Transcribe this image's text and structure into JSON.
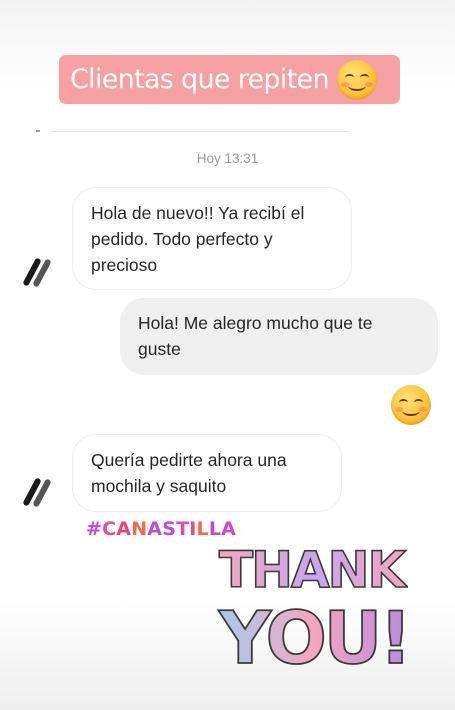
{
  "story": {
    "title": "Clientas que repiten",
    "title_emoji": "smiling-face-icon",
    "title_bg": "#f6a0a3"
  },
  "chat": {
    "timestamp": "Hoy 13:31",
    "messages": [
      {
        "direction": "incoming",
        "text": "Hola de nuevo!! Ya recibí el pedido. Todo perfecto y precioso"
      },
      {
        "direction": "outgoing",
        "text": "Hola! Me alegro mucho que te guste"
      },
      {
        "direction": "outgoing",
        "emoji": "smiling-face-icon"
      },
      {
        "direction": "incoming",
        "text": "Quería pedirte ahora una mochila y saquito"
      }
    ]
  },
  "hashtag": {
    "text": "#CANASTILLA",
    "colors": [
      "#c64ad8",
      "#e24ba8",
      "#f0437a",
      "#f36a4a",
      "#b54ee0"
    ]
  },
  "sticker": {
    "line1": "THANK",
    "line2": "YOU!",
    "colors": {
      "pink": "#f4a6bd",
      "lilac": "#c7a6ec",
      "blue": "#a9c9ee",
      "purple": "#b98ae0"
    }
  }
}
